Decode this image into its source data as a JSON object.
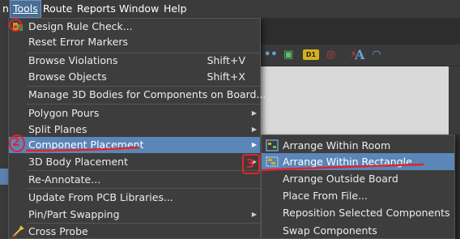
{
  "menubar": {
    "items": [
      {
        "label": "n"
      },
      {
        "label": "Tools",
        "underline": "T"
      },
      {
        "label": "Route",
        "underline": "u"
      },
      {
        "label": "Reports",
        "underline": "R"
      },
      {
        "label": "Window",
        "underline": "W"
      },
      {
        "label": "Help",
        "underline": "H"
      }
    ]
  },
  "tools_menu": {
    "items": [
      {
        "label": "Design Rule Check...",
        "icon": "drc-icon"
      },
      {
        "label": "Reset Error Markers"
      },
      {
        "label": "Browse Violations",
        "shortcut": "Shift+V"
      },
      {
        "label": "Browse Objects",
        "shortcut": "Shift+X"
      },
      {
        "label": "Manage 3D Bodies for Components on Board..."
      },
      {
        "label": "Polygon Pours",
        "submenu": true
      },
      {
        "label": "Split Planes",
        "submenu": true
      },
      {
        "label": "Component Placement",
        "submenu": true,
        "selected": true
      },
      {
        "label": "3D Body Placement",
        "submenu": true
      },
      {
        "label": "Re-Annotate..."
      },
      {
        "label": "Update From PCB Libraries..."
      },
      {
        "label": "Pin/Part Swapping",
        "submenu": true
      },
      {
        "label": "Cross Probe",
        "icon": "cross-probe-icon"
      }
    ]
  },
  "placement_submenu": {
    "items": [
      {
        "label": "Arrange Within Room",
        "icon": "arrange-room-icon"
      },
      {
        "label": "Arrange Within Rectangle",
        "icon": "arrange-rectangle-icon",
        "selected": true
      },
      {
        "label": "Arrange Outside Board"
      },
      {
        "label": "Place From File..."
      },
      {
        "label": "Reposition Selected Components"
      },
      {
        "label": "Swap Components"
      }
    ]
  },
  "annotations": {
    "step2": "2",
    "step3": "3"
  },
  "colors": {
    "menu_bg": "#3d3d3d",
    "highlight": "#5a86b8",
    "annotation_red": "#e0242c"
  }
}
